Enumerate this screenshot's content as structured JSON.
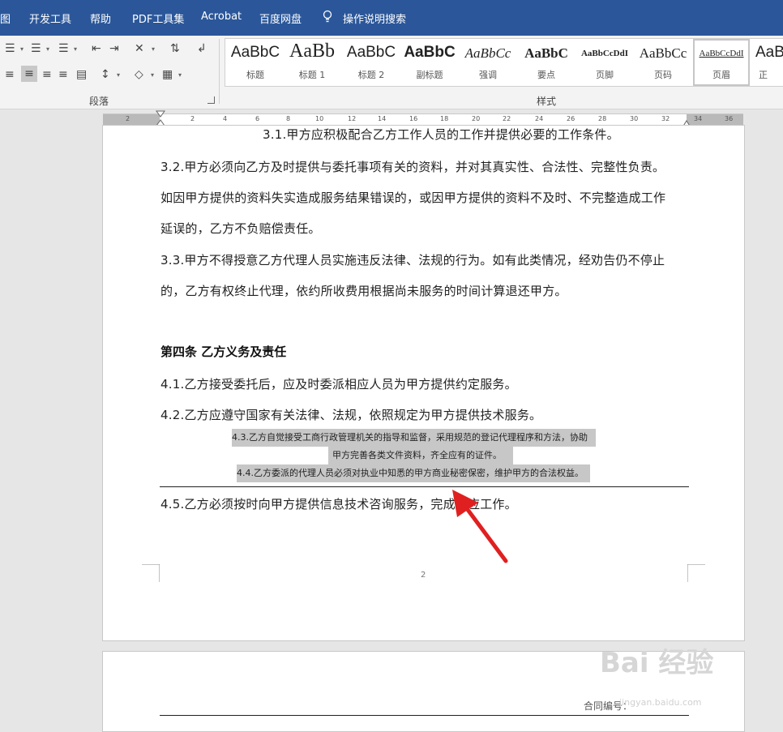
{
  "menu": {
    "items": [
      "图",
      "开发工具",
      "帮助",
      "PDF工具集",
      "Acrobat",
      "百度网盘"
    ],
    "search_label": "操作说明搜索"
  },
  "ribbon": {
    "paragraph_label": "段落",
    "styles_label": "样式",
    "styles": [
      {
        "sample": "AaBbC",
        "label": "标题"
      },
      {
        "sample": "AaBb",
        "label": "标题 1"
      },
      {
        "sample": "AaBbC",
        "label": "标题 2"
      },
      {
        "sample": "AaBbC",
        "label": "副标题"
      },
      {
        "sample": "AaBbCc",
        "label": "强调"
      },
      {
        "sample": "AaBbC",
        "label": "要点"
      },
      {
        "sample": "AaBbCcDdI",
        "label": "页脚"
      },
      {
        "sample": "AaBbCc",
        "label": "页码"
      },
      {
        "sample": "AaBbCcDdI",
        "label": "页眉"
      },
      {
        "sample": "AaB",
        "label": "正"
      }
    ]
  },
  "ruler": {
    "numbers": [
      "2",
      "2",
      "4",
      "6",
      "8",
      "10",
      "12",
      "14",
      "16",
      "18",
      "20",
      "22",
      "24",
      "26",
      "28",
      "30",
      "32",
      "34",
      "36"
    ]
  },
  "document": {
    "p31": "3.1.甲方应积极配合乙方工作人员的工作并提供必要的工作条件。",
    "p32_l1": "3.2.甲方必须向乙方及时提供与委托事项有关的资料，并对其真实性、合法性、完整性负责。",
    "p32_l2": "如因甲方提供的资料失实造成服务结果错误的，或因甲方提供的资料不及时、不完整造成工作",
    "p32_l3": "延误的，乙方不负赔偿责任。",
    "p33_l1": "3.3.甲方不得授意乙方代理人员实施违反法律、法规的行为。如有此类情况，经劝告仍不停止",
    "p33_l2": "的，乙方有权终止代理，依约所收费用根据尚未服务的时间计算退还甲方。",
    "heading4": "第四条  乙方义务及责任",
    "p41": "4.1.乙方接受委托后，应及时委派相应人员为甲方提供约定服务。",
    "p42": "4.2.乙方应遵守国家有关法律、法规，依照规定为甲方提供技术服务。",
    "p43_l1": "4.3.乙方自觉接受工商行政管理机关的指导和监督，采用规范的登记代理程序和方法，协助",
    "p43_l2": "甲方完善各类文件资料，齐全应有的证件。",
    "p44": "4.4.乙方委派的代理人员必须对执业中知悉的甲方商业秘密保密，维护甲方的合法权益。",
    "p45": "4.5.乙方必须按时向甲方提供信息技术咨询服务，完成相应工作。",
    "page_number": "2",
    "contract_label": "合同编号："
  },
  "watermark": {
    "text": "Bai 经验",
    "sub": "jingyan.baidu.com"
  },
  "colors": {
    "menubar": "#2b579a",
    "highlight": "#c7c7c7",
    "arrow": "#e02020"
  }
}
